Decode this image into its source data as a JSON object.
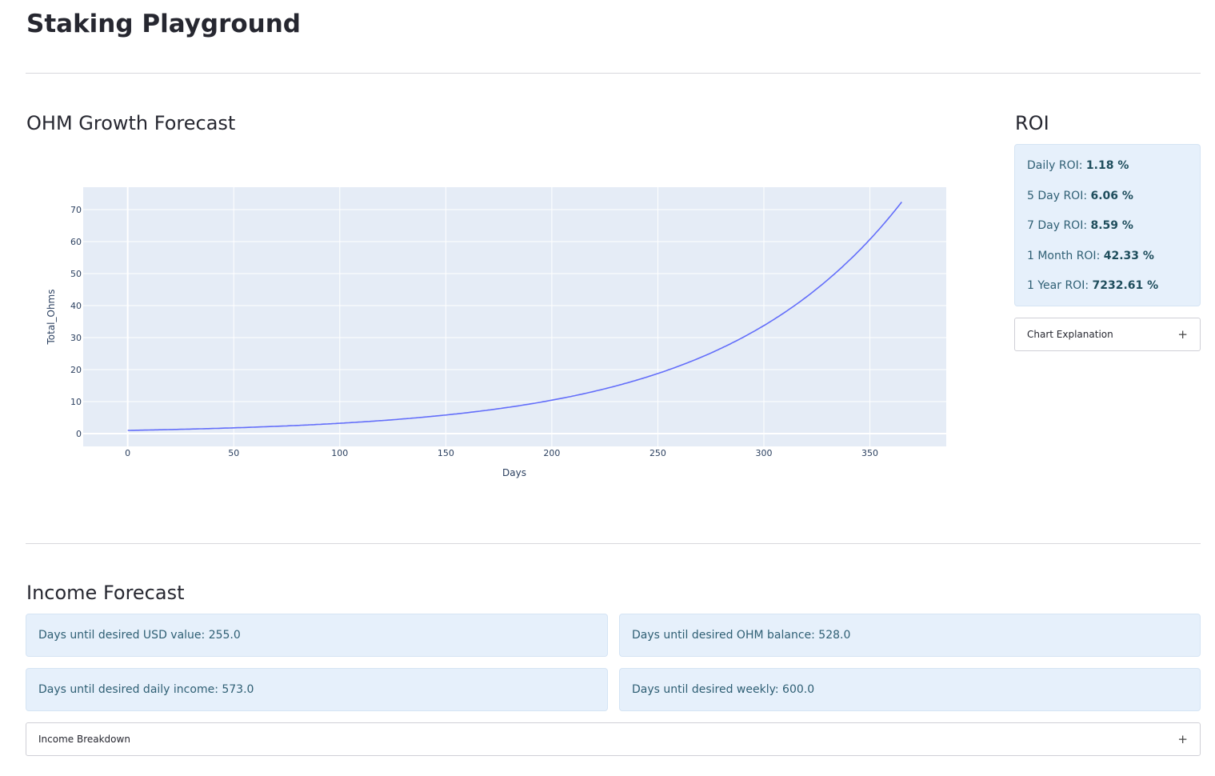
{
  "page": {
    "title": "Staking Playground"
  },
  "growth": {
    "title": "OHM Growth Forecast"
  },
  "chart_data": {
    "type": "line",
    "xlabel": "Days",
    "ylabel": "Total_Ohms",
    "xlim": [
      -21,
      386
    ],
    "ylim": [
      -4,
      77
    ],
    "x_ticks": [
      0,
      50,
      100,
      150,
      200,
      250,
      300,
      350
    ],
    "y_ticks": [
      0,
      10,
      20,
      30,
      40,
      50,
      60,
      70
    ],
    "grid": true,
    "legend": "none",
    "series": [
      {
        "start": {
          "x": 0,
          "y": 1
        },
        "end": {
          "x": 365,
          "y": 73.3
        },
        "daily_growth_rate": 0.0118,
        "color": "#636efa"
      }
    ]
  },
  "roi": {
    "title": "ROI",
    "items": [
      {
        "label": "Daily ROI: ",
        "value": "1.18 %"
      },
      {
        "label": "5 Day ROI: ",
        "value": "6.06 %"
      },
      {
        "label": "7 Day ROI: ",
        "value": "8.59 %"
      },
      {
        "label": "1 Month ROI: ",
        "value": "42.33 %"
      },
      {
        "label": "1 Year ROI: ",
        "value": "7232.61 %"
      }
    ],
    "expander_label": "Chart Explanation",
    "expander_icon": "+"
  },
  "income": {
    "title": "Income Forecast",
    "usd_value": "Days until desired USD value: 255.0",
    "ohm_balance": "Days until desired OHM balance: 528.0",
    "daily_income": "Days until desired daily income: 573.0",
    "weekly": "Days until desired weekly: 600.0",
    "expander_label": "Income Breakdown",
    "expander_icon": "+"
  }
}
